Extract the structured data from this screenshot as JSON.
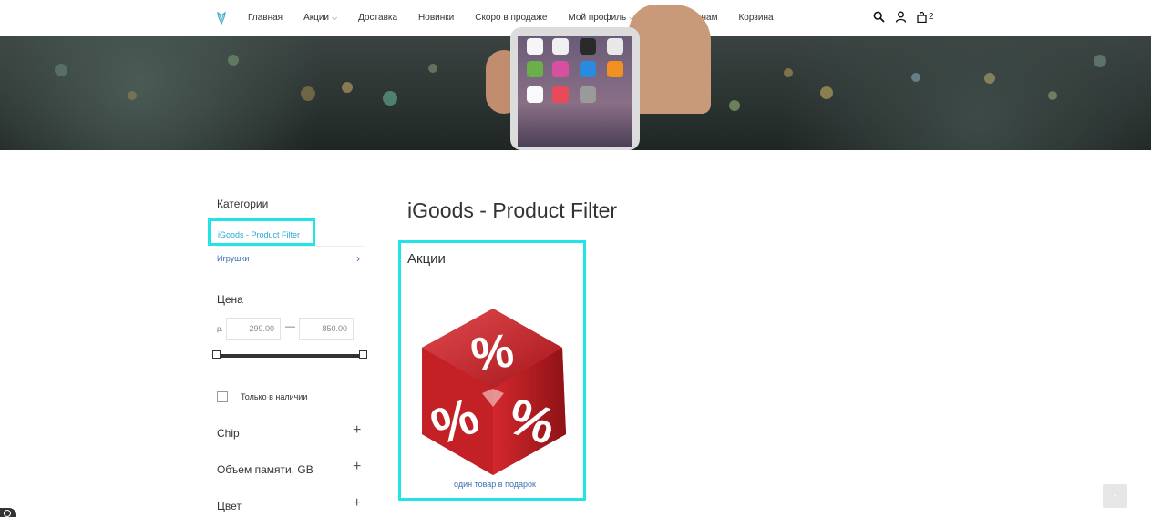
{
  "nav": {
    "items": [
      {
        "label": "Главная",
        "dropdown": false
      },
      {
        "label": "Акции",
        "dropdown": true
      },
      {
        "label": "Доставка",
        "dropdown": false
      },
      {
        "label": "Новинки",
        "dropdown": false
      },
      {
        "label": "Скоро в продаже",
        "dropdown": false
      },
      {
        "label": "Мой профиль",
        "dropdown": true
      },
      {
        "label": "Напишите нам",
        "dropdown": false
      },
      {
        "label": "Корзина",
        "dropdown": false
      }
    ],
    "cart_count": "2",
    "icons": [
      "search-icon",
      "user-icon",
      "shopping-bag-icon"
    ]
  },
  "sidebar": {
    "categories_title": "Категории",
    "categories": [
      {
        "label": "iGoods - Product Filter",
        "active": true
      },
      {
        "label": "Игрушки",
        "active": false
      }
    ],
    "price_title": "Цена",
    "currency": "р.",
    "price_min": "299.00",
    "price_max": "850.00",
    "price_separator": "—",
    "in_stock_label": "Только в наличии",
    "filters": [
      "Chip",
      "Объем памяти, GB",
      "Цвет"
    ]
  },
  "main": {
    "title": "iGoods - Product Filter",
    "card": {
      "title": "Акции",
      "caption": "один товар в подарок"
    }
  },
  "colors": {
    "accent": "#22e3e8",
    "link": "#3a6fb0",
    "active_link": "#29a8d8",
    "promo_red": "#c8282c"
  }
}
